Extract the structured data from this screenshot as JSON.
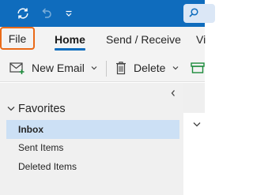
{
  "colors": {
    "titlebar": "#0f6cbd",
    "ribbon_bg": "#f3f3f3",
    "file_highlight": "#ea6a18",
    "selected_folder": "#cce0f5",
    "accent": "#0f6cbd"
  },
  "titlebar": {
    "icons": [
      "sync-icon",
      "undo-icon",
      "customize-qat-icon",
      "search-icon"
    ]
  },
  "ribbon": {
    "tabs": [
      {
        "label": "File"
      },
      {
        "label": "Home"
      },
      {
        "label": "Send / Receive"
      },
      {
        "label": "Vi"
      }
    ],
    "active_tab": "Home"
  },
  "toolbar": {
    "new_email_label": "New Email",
    "delete_label": "Delete",
    "icons": [
      "new-email-icon",
      "chevron-down-icon",
      "delete-icon",
      "chevron-down-icon",
      "archive-icon"
    ]
  },
  "folder_pane": {
    "favorites_label": "Favorites",
    "folders": [
      {
        "label": "Inbox",
        "selected": true
      },
      {
        "label": "Sent Items"
      },
      {
        "label": "Deleted Items"
      }
    ]
  }
}
